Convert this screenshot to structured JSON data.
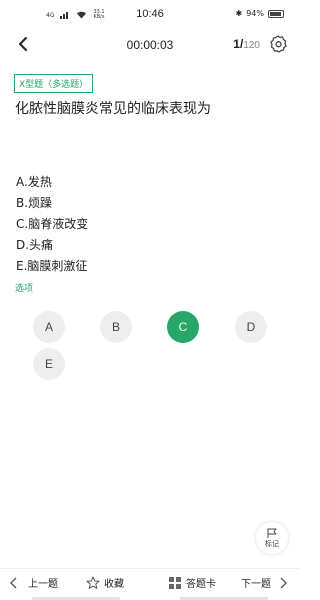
{
  "status": {
    "network": "4G",
    "speed": "33.1 KB/s",
    "time": "10:46",
    "battery": "94%"
  },
  "nav": {
    "timer": "00:00:03",
    "current": "1/",
    "total": "120"
  },
  "question": {
    "type_tag": "X型题（多选题）",
    "text": "化脓性脑膜炎常见的临床表现为",
    "options": [
      "A.发热",
      "B.烦躁",
      "C.脑脊液改变",
      "D.头痛",
      "E.脑膜刺激征"
    ]
  },
  "answer": {
    "label": "选项",
    "choices": [
      "A",
      "B",
      "C",
      "D",
      "E"
    ],
    "selected": "C"
  },
  "mark": {
    "label": "标记"
  },
  "bottom": {
    "prev": "上一题",
    "favorite": "收藏",
    "card": "答题卡",
    "next": "下一题"
  },
  "colors": {
    "accent": "#27a765"
  }
}
